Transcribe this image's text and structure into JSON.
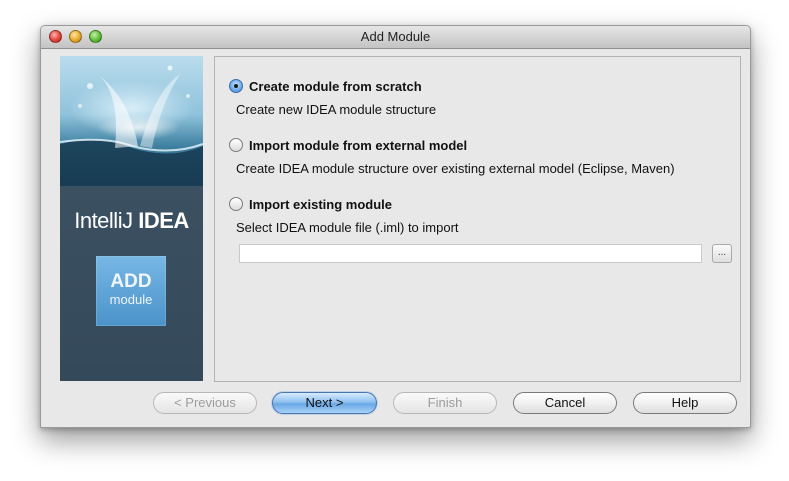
{
  "window": {
    "title": "Add Module"
  },
  "sidebar": {
    "brand_light": "IntelliJ ",
    "brand_bold": "IDEA",
    "badge_line1": "ADD",
    "badge_line2": "module"
  },
  "options": [
    {
      "label": "Create module from scratch",
      "description": "Create new IDEA module structure",
      "selected": true
    },
    {
      "label": "Import module from external model",
      "description": "Create IDEA module structure over existing external model (Eclipse, Maven)",
      "selected": false
    },
    {
      "label": "Import existing module",
      "description": "Select IDEA module file (.iml) to import",
      "selected": false
    }
  ],
  "module_file": {
    "value": "",
    "browse_label": "..."
  },
  "buttons": {
    "previous": "< Previous",
    "next": "Next >",
    "finish": "Finish",
    "cancel": "Cancel",
    "help": "Help"
  }
}
